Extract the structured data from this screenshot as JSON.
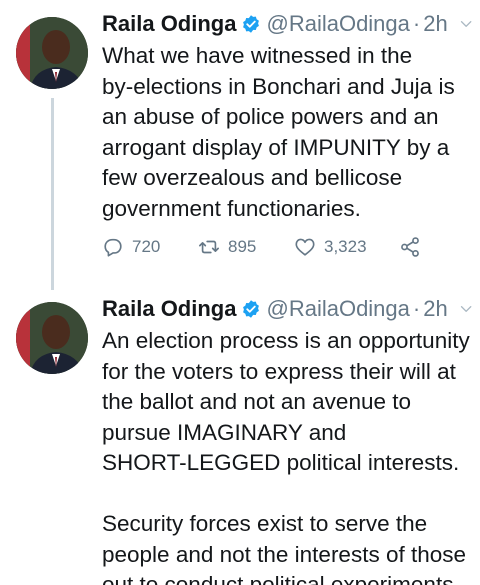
{
  "tweets": [
    {
      "author_name": "Raila Odinga",
      "handle": "@RailaOdinga",
      "separator": "·",
      "time": "2h",
      "text": "What we have witnessed in the\nby-elections in Bonchari and Juja is\nan abuse of police powers and an\narrogant display of IMPUNITY by a\nfew overzealous and bellicose\ngovernment functionaries.",
      "replies": "720",
      "retweets": "895",
      "likes": "3,323"
    },
    {
      "author_name": "Raila Odinga",
      "handle": "@RailaOdinga",
      "separator": "·",
      "time": "2h",
      "text": "An election process is an opportunity\nfor the voters to express their will at\nthe ballot and not an avenue to\npursue IMAGINARY and\nSHORT-LEGGED political interests.\n\nSecurity forces exist to serve the\npeople and not the interests of those\nout to conduct political experiments."
    }
  ],
  "icons": {
    "verified": "verified-badge-icon",
    "more": "chevron-down-icon",
    "reply": "reply-icon",
    "retweet": "retweet-icon",
    "like": "heart-icon",
    "share": "share-icon"
  },
  "colors": {
    "verified_blue": "#1da1f2",
    "secondary_text": "#657786",
    "thread_line": "#ccd6dd"
  }
}
